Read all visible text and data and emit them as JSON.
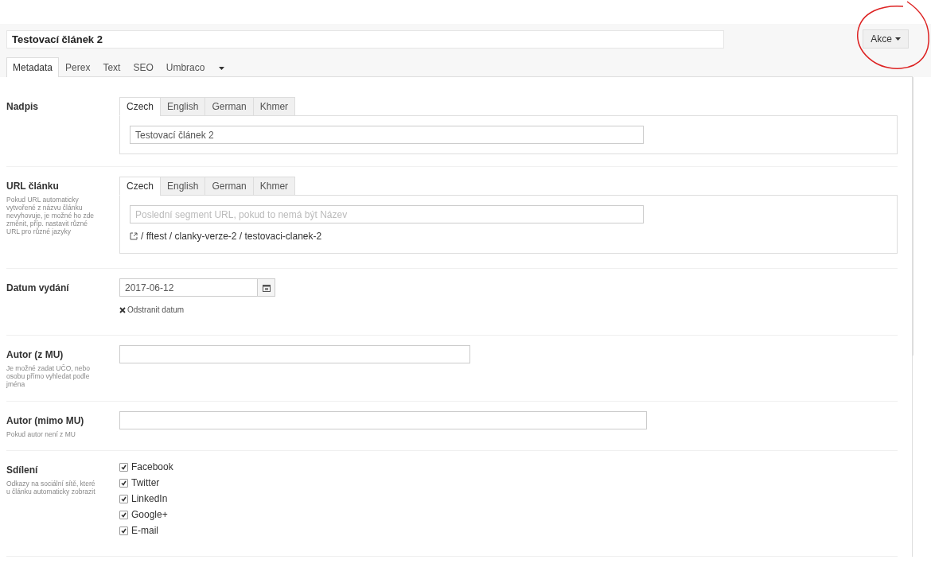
{
  "title_field": {
    "value": "Testovací článek 2"
  },
  "actions_button": {
    "label": "Akce"
  },
  "tabs": [
    {
      "label": "Metadata",
      "selected": true
    },
    {
      "label": "Perex",
      "selected": false
    },
    {
      "label": "Text",
      "selected": false
    },
    {
      "label": "SEO",
      "selected": false
    },
    {
      "label": "Umbraco",
      "selected": false
    }
  ],
  "fields": [
    {
      "kind": "lang_text",
      "label": "Nadpis",
      "languages": [
        {
          "label": "Czech",
          "selected": true
        },
        {
          "label": "English",
          "selected": false
        },
        {
          "label": "German",
          "selected": false
        },
        {
          "label": "Khmer",
          "selected": false
        }
      ],
      "value": "Testovací článek 2"
    },
    {
      "kind": "lang_url",
      "label": "URL článku",
      "help": "Pokud URL automaticky vytvořené z názvu článku nevyhovuje, je možné ho zde změnit, příp. nastavit různé URL pro různé jazyky",
      "languages": [
        {
          "label": "Czech",
          "selected": true
        },
        {
          "label": "English",
          "selected": false
        },
        {
          "label": "German",
          "selected": false
        },
        {
          "label": "Khmer",
          "selected": false
        }
      ],
      "placeholder": "Poslední segment URL, pokud to nemá být Název",
      "path": "/ fftest / clanky-verze-2 / testovaci-clanek-2"
    },
    {
      "kind": "date",
      "label": "Datum vydání",
      "value": "2017-06-12",
      "clear_label": "Odstranit datum"
    },
    {
      "kind": "lookup",
      "label": "Autor (z MU)",
      "help": "Je možné zadat UČO, nebo osobu přímo vyhledat podle jména"
    },
    {
      "kind": "text",
      "label": "Autor (mimo MU)",
      "help": "Pokud autor není z MU"
    },
    {
      "kind": "checkboxes",
      "label": "Sdílení",
      "help": "Odkazy na sociální sítě, které u článku automaticky zobrazit",
      "options": [
        {
          "label": "Facebook",
          "checked": true
        },
        {
          "label": "Twitter",
          "checked": true
        },
        {
          "label": "LinkedIn",
          "checked": true
        },
        {
          "label": "Google+",
          "checked": true
        },
        {
          "label": "E-mail",
          "checked": true
        }
      ]
    }
  ]
}
